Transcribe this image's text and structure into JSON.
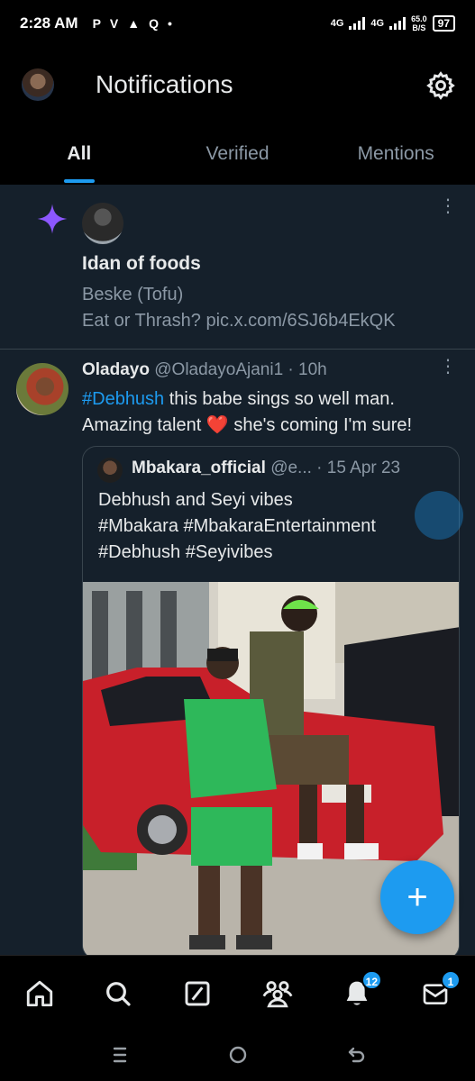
{
  "status_bar": {
    "time": "2:28 AM",
    "left_icons": [
      "P",
      "V",
      "▲",
      "Q",
      "•"
    ],
    "network_1": "4G",
    "network_2": "4G",
    "speed": "65.0",
    "speed_unit": "B/S",
    "battery": "97"
  },
  "header": {
    "title": "Notifications",
    "tabs": [
      {
        "label": "All",
        "active": true
      },
      {
        "label": "Verified",
        "active": false
      },
      {
        "label": "Mentions",
        "active": false
      }
    ]
  },
  "notifications": [
    {
      "type": "recommendation",
      "icon": "sparkle-icon",
      "title": "Idan of foods",
      "line1": "Beske (Tofu)",
      "line2": "Eat or Thrash? pic.x.com/6SJ6b4EkQK"
    }
  ],
  "tweet": {
    "name": "Oladayo",
    "handle": "@OladayoAjani1",
    "separator": "·",
    "time": "10h",
    "hashtag": "#Debhush",
    "text_part1": " this babe sings so well man.",
    "text_part2": "Amazing talent ",
    "text_part3": " she's coming I'm sure!",
    "emoji": "❤️",
    "quote": {
      "name": "Mbakara_official",
      "handle": "@e...",
      "separator": "·",
      "date": "15 Apr 23",
      "line1": "Debhush and Seyi vibes",
      "line2": "#Mbakara #MbakaraEntertainment",
      "line3": "#Debhush #Seyivibes"
    }
  },
  "fab": {
    "label": "+"
  },
  "bottom_nav": {
    "items": [
      {
        "name": "home",
        "icon": "home-icon"
      },
      {
        "name": "search",
        "icon": "search-icon"
      },
      {
        "name": "grok",
        "icon": "grok-icon"
      },
      {
        "name": "communities",
        "icon": "communities-icon"
      },
      {
        "name": "notifications",
        "icon": "bell-icon",
        "badge": "12"
      },
      {
        "name": "messages",
        "icon": "mail-icon",
        "badge": "1"
      }
    ]
  },
  "colors": {
    "accent": "#1d9bf0",
    "background": "#15202b",
    "muted": "#8b98a5",
    "sparkle": "#8c57ff"
  }
}
